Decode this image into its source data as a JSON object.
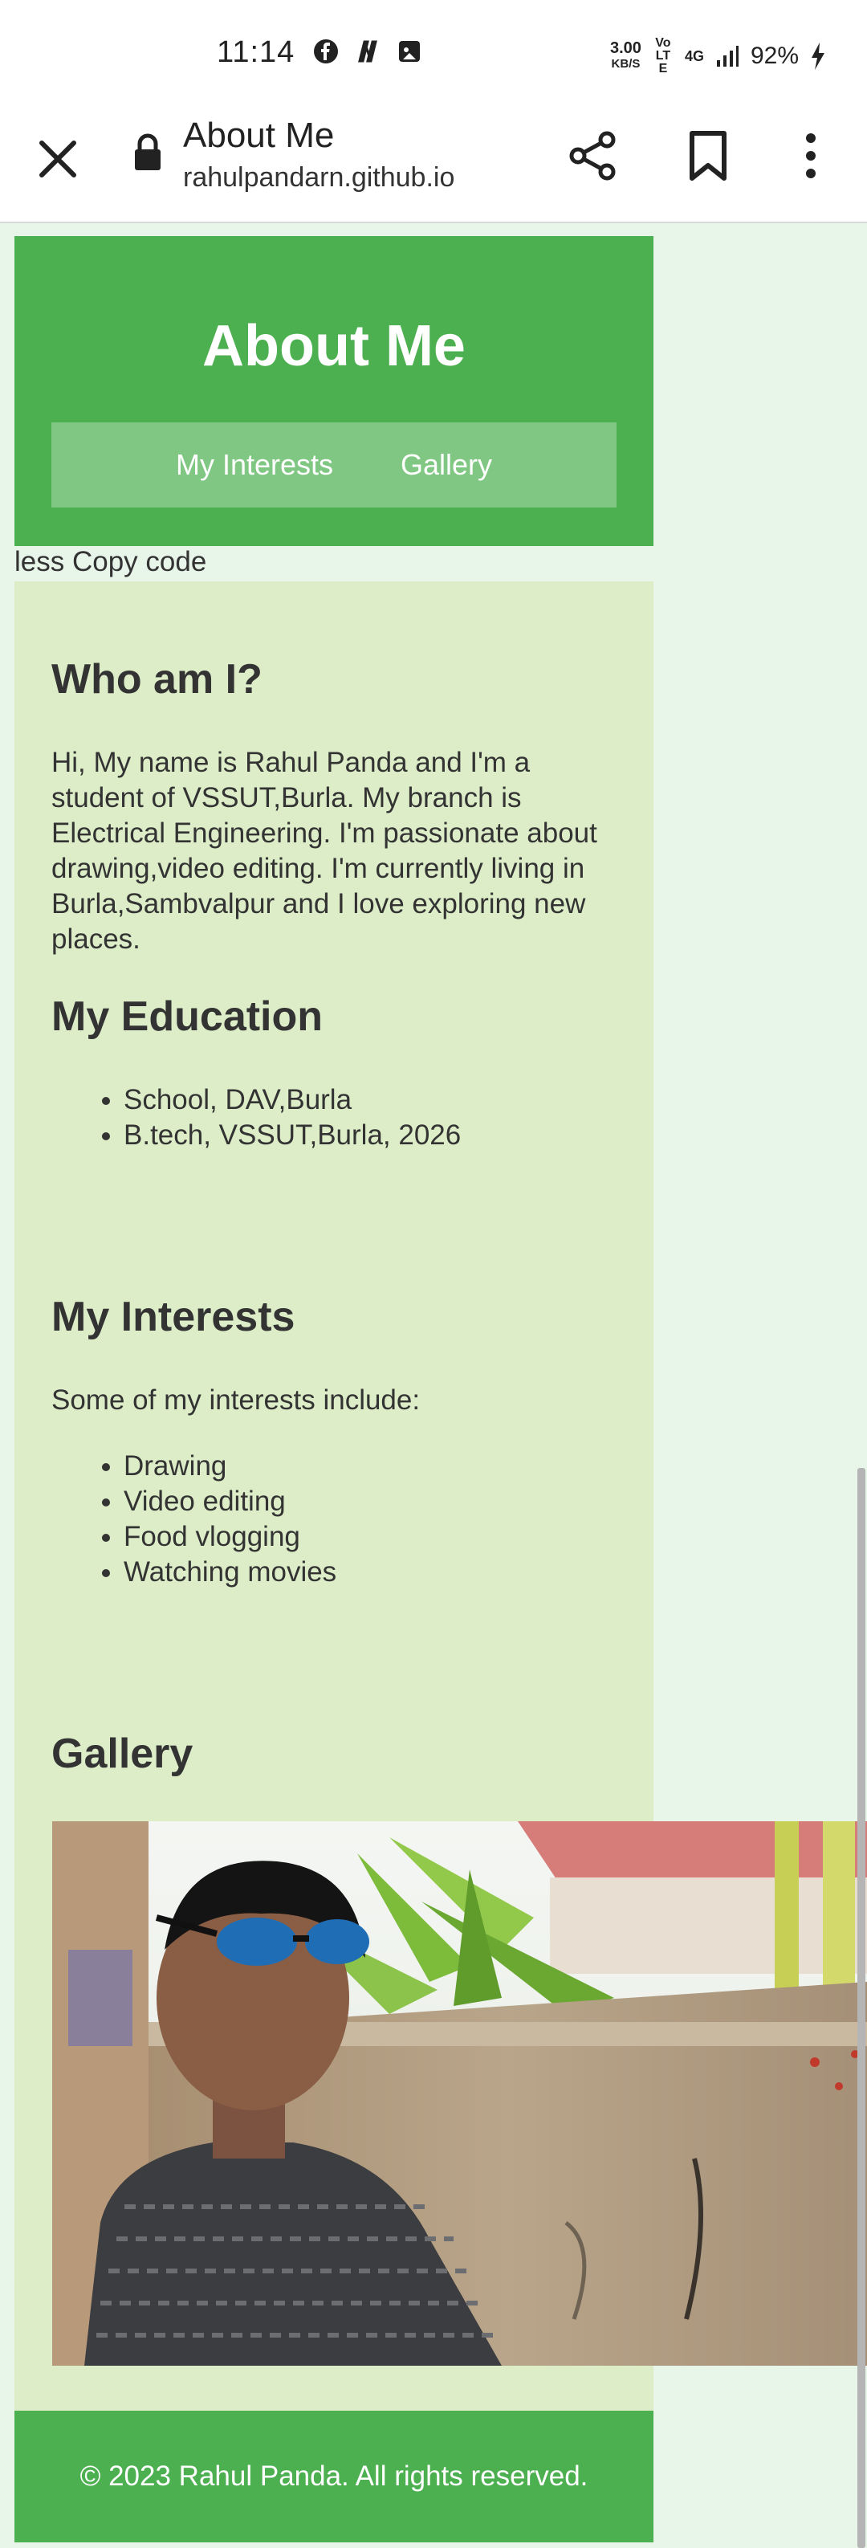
{
  "status_bar": {
    "time": "11:14",
    "speed_value": "3.00",
    "speed_unit": "KB/S",
    "volte": "Vo LTE",
    "network": "4G",
    "battery": "92%"
  },
  "browser": {
    "title": "About Me",
    "url": "rahulpandarn.github.io"
  },
  "header": {
    "title": "About Me",
    "nav": [
      "My Interests",
      "Gallery"
    ]
  },
  "stray_text": "less Copy code",
  "who": {
    "heading": "Who am I?",
    "text": "Hi, My name is Rahul Panda and I'm a student of VSSUT,Burla. My branch is Electrical Engineering. I'm passionate about drawing,video editing. I'm currently living in Burla,Sambvalpur and I love exploring new places."
  },
  "education": {
    "heading": "My Education",
    "items": [
      "School, DAV,Burla",
      "B.tech, VSSUT,Burla, 2026"
    ]
  },
  "interests": {
    "heading": "My Interests",
    "intro": "Some of my interests include:",
    "items": [
      "Drawing",
      "Video editing",
      "Food vlogging",
      "Watching movies"
    ]
  },
  "gallery": {
    "heading": "Gallery"
  },
  "footer": {
    "text": "© 2023 Rahul Panda. All rights reserved."
  },
  "colors": {
    "header_bg": "#4caf50",
    "nav_bg": "#81c784",
    "content_bg": "#dcedc8",
    "page_bg": "#e8f5e9"
  }
}
